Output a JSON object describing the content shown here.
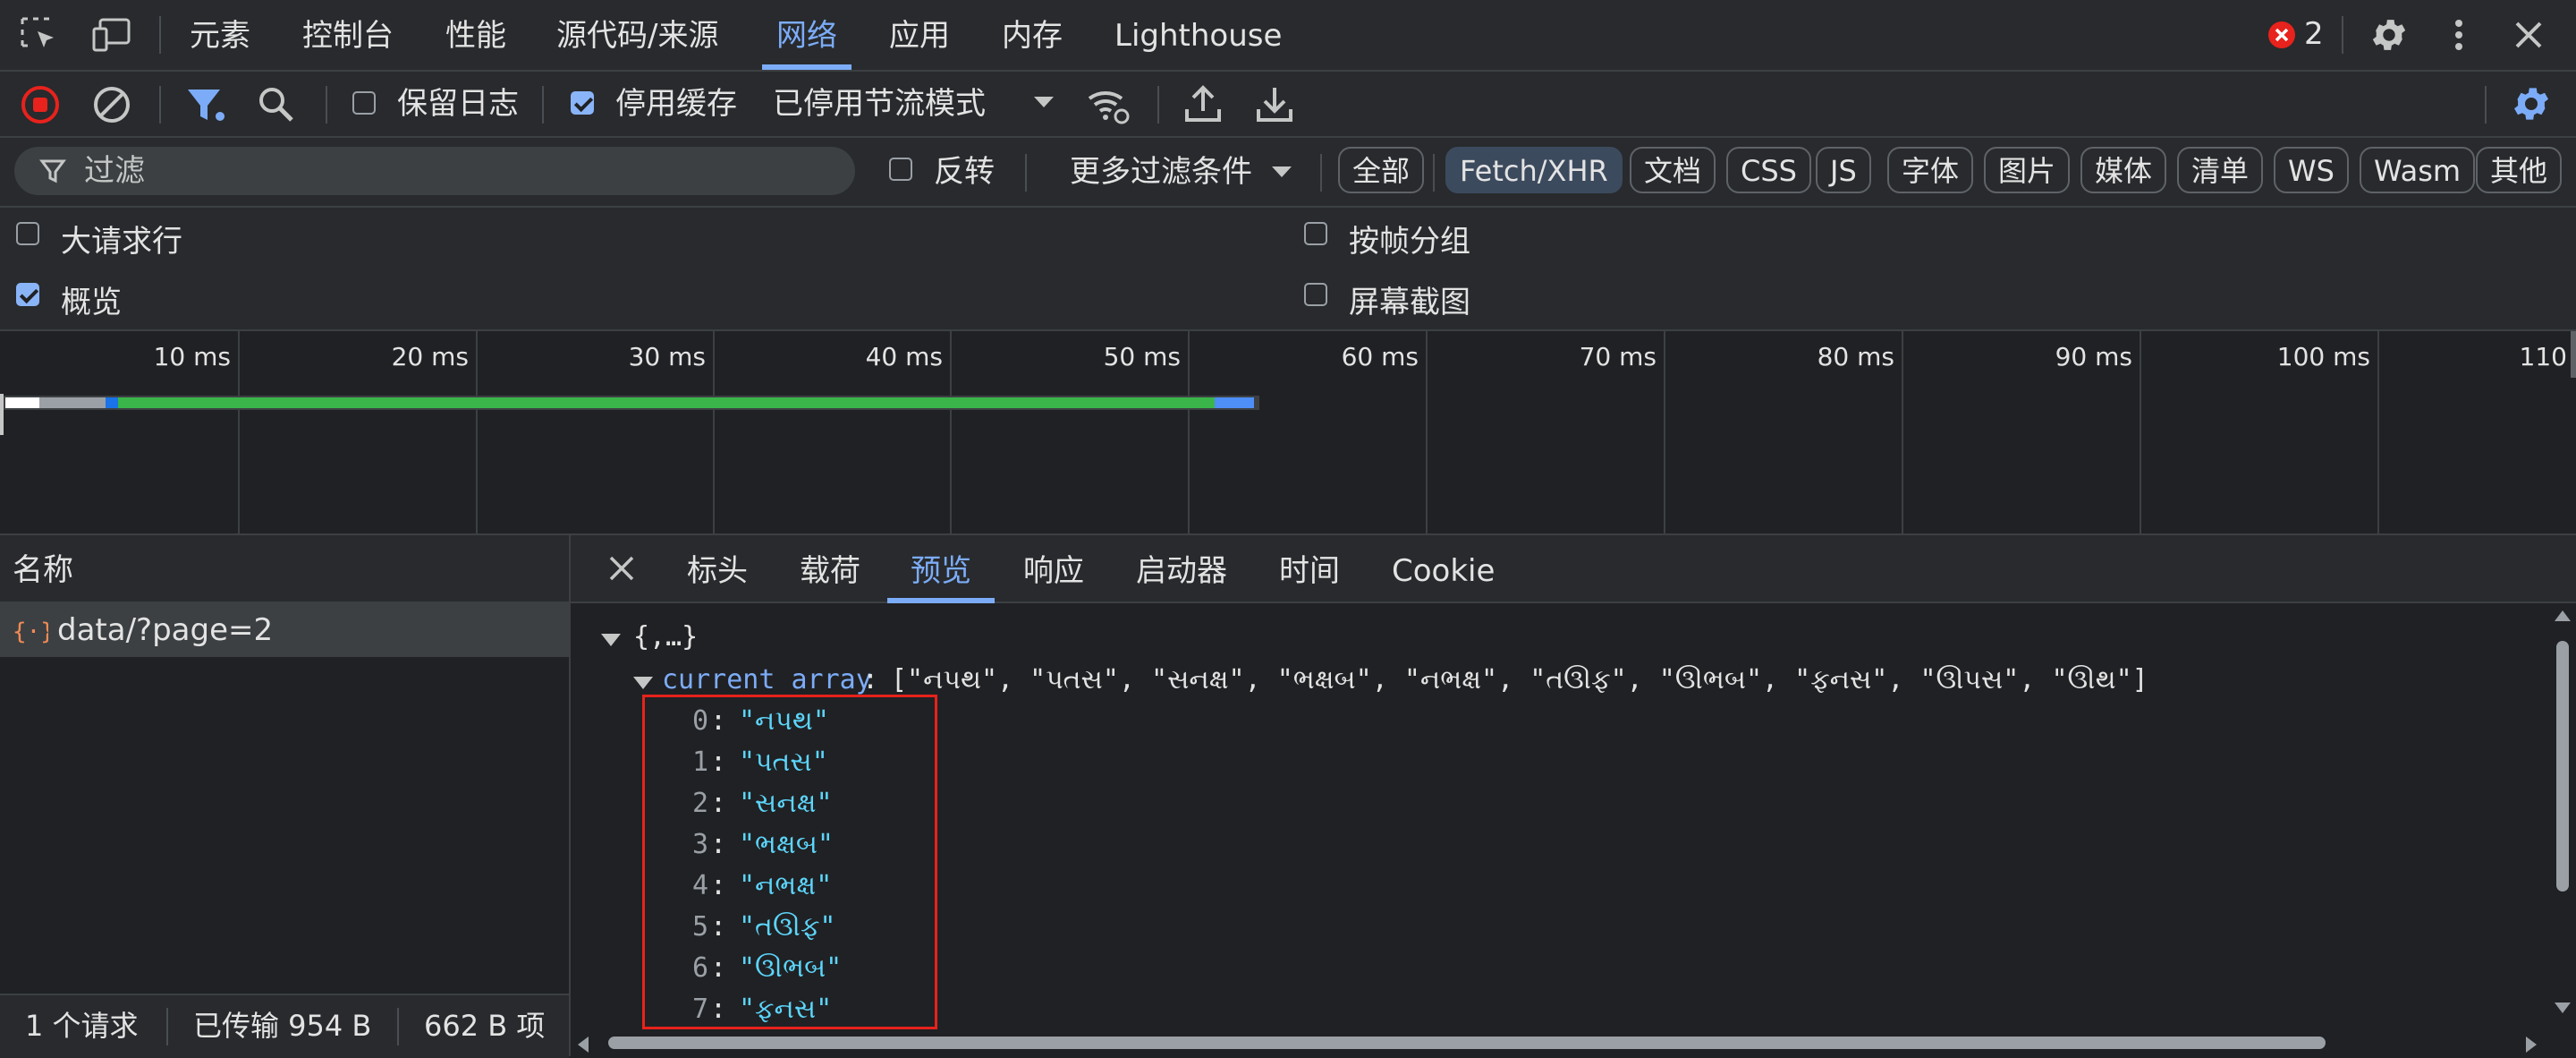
{
  "tabs": {
    "items": [
      "元素",
      "控制台",
      "性能",
      "源代码/来源",
      "网络",
      "应用",
      "内存",
      "Lighthouse"
    ],
    "active": "网络",
    "error_count": "2"
  },
  "toolbar": {
    "preserve_log_label": "保留日志",
    "preserve_log_checked": false,
    "disable_cache_label": "停用缓存",
    "disable_cache_checked": true,
    "throttling_value": "已停用节流模式"
  },
  "filter": {
    "placeholder": "过滤",
    "invert_label": "反转",
    "invert_checked": false,
    "more_filters_label": "更多过滤条件",
    "types": [
      "全部",
      "Fetch/XHR",
      "文档",
      "CSS",
      "JS",
      "字体",
      "图片",
      "媒体",
      "清单",
      "WS",
      "Wasm",
      "其他"
    ],
    "active_type": "Fetch/XHR"
  },
  "options": {
    "big_request_rows": "大请求行",
    "big_request_rows_checked": false,
    "overview": "概览",
    "overview_checked": true,
    "group_by_frame": "按帧分组",
    "group_by_frame_checked": false,
    "screenshots": "屏幕截图",
    "screenshots_checked": false
  },
  "timeline": {
    "ticks": [
      "10 ms",
      "20 ms",
      "30 ms",
      "40 ms",
      "50 ms",
      "60 ms",
      "70 ms",
      "80 ms",
      "90 ms",
      "100 ms",
      "110"
    ]
  },
  "requests": {
    "header": "名称",
    "rows": [
      {
        "icon": "xhr-json-icon",
        "name": "data/?page=2"
      }
    ]
  },
  "status": {
    "requests": "1 个请求",
    "transferred": "已传输 954 B",
    "resources": "662 B 项"
  },
  "details": {
    "tabs": [
      "标头",
      "载荷",
      "预览",
      "响应",
      "启动器",
      "时间",
      "Cookie"
    ],
    "active": "预览",
    "root_label": "{,…}",
    "array_key": "current array",
    "array_summary": "[\"નપથ\", \"પતસ\", \"સનક્ષ\", \"ભક્ષબ\", \"નભક્ષ\", \"તઊફ\", \"ઊભબ\", \"ફનસ\", \"ઊપસ\", \"ઊથ\"]",
    "items": [
      {
        "index": "0",
        "value": "\"નપથ\""
      },
      {
        "index": "1",
        "value": "\"પતસ\""
      },
      {
        "index": "2",
        "value": "\"સનક્ષ\""
      },
      {
        "index": "3",
        "value": "\"ભક્ષબ\""
      },
      {
        "index": "4",
        "value": "\"નભક્ષ\""
      },
      {
        "index": "5",
        "value": "\"તઊફ\""
      },
      {
        "index": "6",
        "value": "\"ઊભબ\""
      },
      {
        "index": "7",
        "value": "\"ફનસ\""
      }
    ]
  },
  "colors": {
    "accent": "#7cacf8",
    "error": "#e8221c",
    "string_value": "#5cd5fb",
    "timeline_green": "#3ab54a",
    "timeline_blue": "#4e8ef7"
  }
}
